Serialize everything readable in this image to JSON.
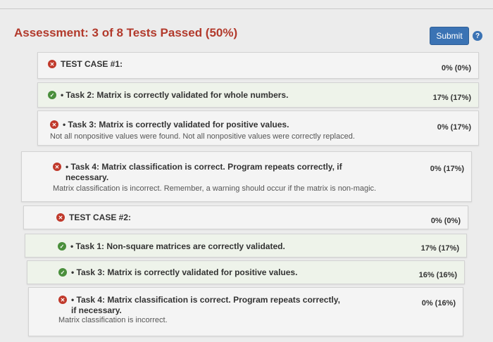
{
  "header": {
    "title": "Assessment: 3 of 8 Tests Passed (50%)",
    "submit_label": "Submit",
    "help_glyph": "?"
  },
  "results": [
    {
      "status": "fail",
      "name": "TEST CASE #1:",
      "desc": "",
      "score": "0%  (0%)"
    },
    {
      "status": "pass",
      "name": "• Task 2: Matrix is correctly validated for whole numbers.",
      "desc": "",
      "score": "17%  (17%)"
    },
    {
      "status": "fail",
      "name": "• Task 3: Matrix is correctly validated for positive values.",
      "desc": "Not all nonpositive values were found. Not all nonpositive values were correctly replaced.",
      "score": "0%  (17%)"
    },
    {
      "status": "fail",
      "name": "• Task 4: Matrix classification is correct. Program repeats correctly, if necessary.",
      "desc": "Matrix classification is incorrect. Remember, a warning should occur if the matrix is non-magic.",
      "score": "0%  (17%)"
    },
    {
      "status": "fail",
      "name": "TEST CASE #2:",
      "desc": "",
      "score": "0%  (0%)"
    },
    {
      "status": "pass",
      "name": "• Task 1: Non-square matrices are correctly validated.",
      "desc": "",
      "score": "17%  (17%)"
    },
    {
      "status": "pass",
      "name": "• Task 3: Matrix is correctly validated for positive values.",
      "desc": "",
      "score": "16%  (16%)"
    },
    {
      "status": "fail",
      "name": "• Task 4: Matrix classification is correct. Program repeats correctly, if necessary.",
      "desc": "Matrix classification is incorrect.",
      "score": "0%  (16%)"
    }
  ],
  "icons": {
    "fail": "x-circle-icon",
    "pass": "check-circle-icon"
  },
  "colors": {
    "title": "#b23a2c",
    "fail": "#c0392b",
    "pass": "#4a8f3c",
    "submit": "#3b73b4"
  }
}
